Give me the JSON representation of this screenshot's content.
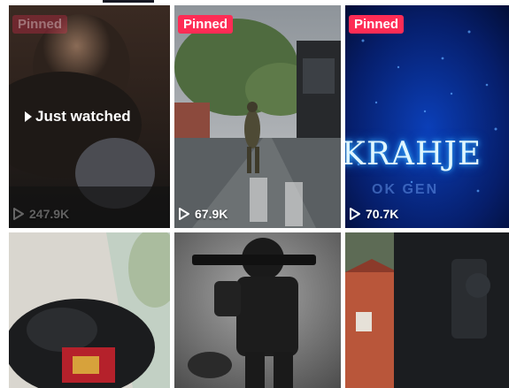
{
  "tabs": {
    "active_indicator": "active-tab-underline"
  },
  "tiles": [
    {
      "badge": "Pinned",
      "overlay": "Just watched",
      "views": "247.9K"
    },
    {
      "badge": "Pinned",
      "views": "67.9K"
    },
    {
      "badge": "Pinned",
      "views": "70.7K",
      "overlay_text": "KRAHJE",
      "overlay_subtext": "OK GEN"
    },
    {},
    {},
    {}
  ],
  "colors": {
    "pinned_badge": "#fe2c55",
    "views_text": "#ffffff"
  },
  "icons": {
    "views": "play-outline-icon",
    "watched": "play-triangle-icon"
  }
}
